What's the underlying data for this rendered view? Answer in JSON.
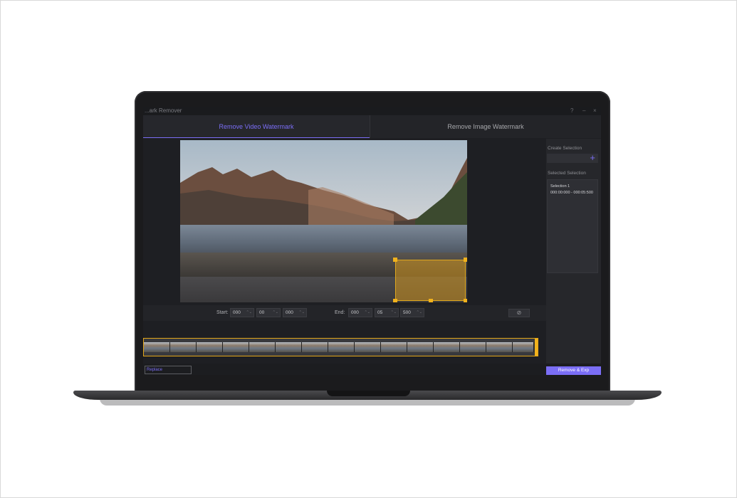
{
  "app": {
    "title": "...ark Remover",
    "window_controls": [
      "?",
      "–",
      "×"
    ]
  },
  "tabs": [
    {
      "label": "Remove Video Watermark",
      "active": true
    },
    {
      "label": "Remove Image Watermark",
      "active": false
    }
  ],
  "side_panel": {
    "create_label": "Create Selection",
    "add_icon": "+",
    "selected_label": "Selected Selection",
    "items": [
      {
        "name": "Selection 1",
        "range": "000:00:000 - 000:05:500"
      }
    ]
  },
  "time": {
    "start_label": "Start:",
    "start": [
      "000",
      "00",
      "000"
    ],
    "end_label": "End:",
    "end": [
      "000",
      "05",
      "500"
    ],
    "spin_arrow": "⌃⌄",
    "visibility_icon": "⊘"
  },
  "buttons": {
    "replace": "Replace",
    "remove_export": "Remove & Exp"
  },
  "colors": {
    "accent": "#7b6ef6",
    "selection": "#e3a619"
  }
}
